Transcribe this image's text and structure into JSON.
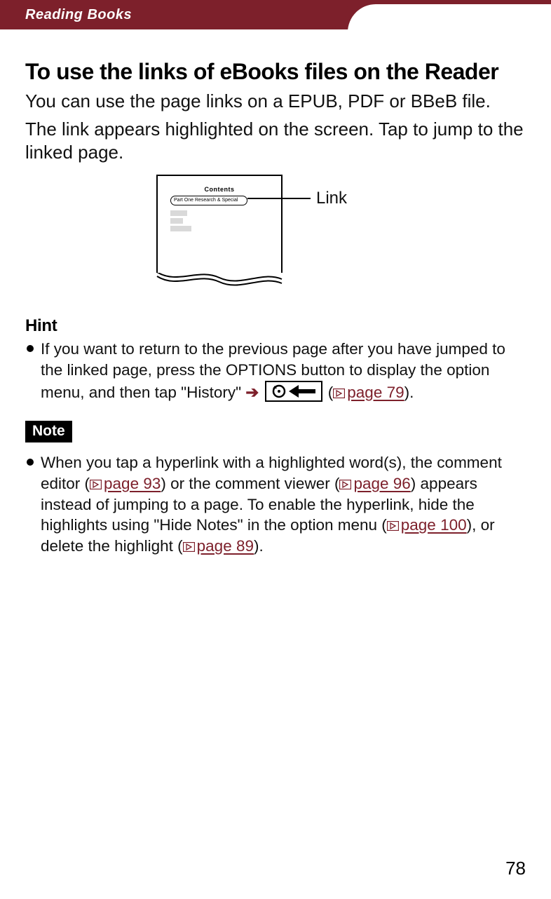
{
  "header": {
    "section": "Reading Books"
  },
  "title": "To use the links of eBooks files on the Reader",
  "intro1": "You can use the page links on a EPUB, PDF or BBeB file.",
  "intro2": "The link appears highlighted on the screen. Tap to jump to the linked page.",
  "diagram": {
    "doc_title": "Contents",
    "link_text": "Part One  Research & Special",
    "callout": "Link"
  },
  "hint": {
    "heading": "Hint",
    "text_a": "If you want to return to the previous page after you have jumped to the linked page, press the OPTIONS button to display the option menu, and then tap \"History\" ",
    "text_b_open": "(",
    "link1": "page 79",
    "text_b_close": ")."
  },
  "note": {
    "badge": "Note",
    "t1": "When you tap a hyperlink with a highlighted word(s), the comment editor (",
    "link_a": "page 93",
    "t2": ") or the comment viewer (",
    "link_b": "page 96",
    "t3": ") appears instead of jumping to a page. To enable the hyperlink, hide the highlights using \"Hide Notes\" in the option menu (",
    "link_c": "page 100",
    "t4": "), or delete the highlight (",
    "link_d": "page 89",
    "t5": ")."
  },
  "page_number": "78"
}
